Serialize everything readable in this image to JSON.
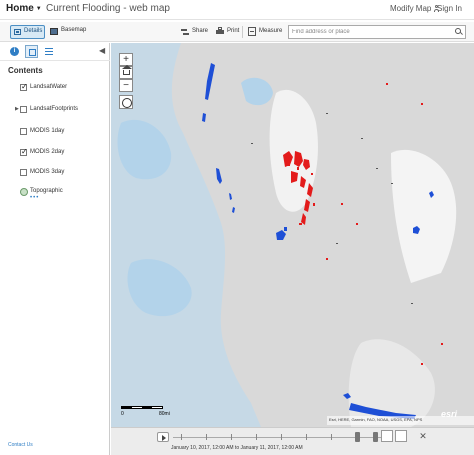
{
  "nav": {
    "home": "Home",
    "title": "Current Flooding - web map",
    "modify": "Modify Map",
    "signin": "Sign In"
  },
  "toolbar": {
    "details": "Details",
    "basemap": "Basemap",
    "share": "Share",
    "print": "Print",
    "measure": "Measure",
    "search_placeholder": "Find address or place"
  },
  "sidebar": {
    "contents_title": "Contents",
    "layers": [
      {
        "label": "LandsatWater",
        "checked": true
      },
      {
        "label": "LandsatFootprints",
        "checked": false,
        "expandable": true
      },
      {
        "label": "MODIS 1day",
        "checked": false
      },
      {
        "label": "MODIS 2day",
        "checked": true
      },
      {
        "label": "MODIS 3day",
        "checked": false
      },
      {
        "label": "Topographic",
        "basemap": true
      }
    ],
    "more": "•••",
    "contact": "Contact Us"
  },
  "map": {
    "scale_label": "0",
    "scale_end": "80mi",
    "attribution": "Esri, HERE, Garmin, FAO, NOAA, USGS, EPA, NPS",
    "logo": "esri",
    "colors": {
      "land": "#d9d9d9",
      "lake": "#b8d8ee",
      "flood_red": "#e31b1b",
      "water_blue": "#1e4fd6"
    }
  },
  "timeslider": {
    "label": "January 10, 2017, 12:00 AM to January 11, 2017, 12:00 AM"
  }
}
